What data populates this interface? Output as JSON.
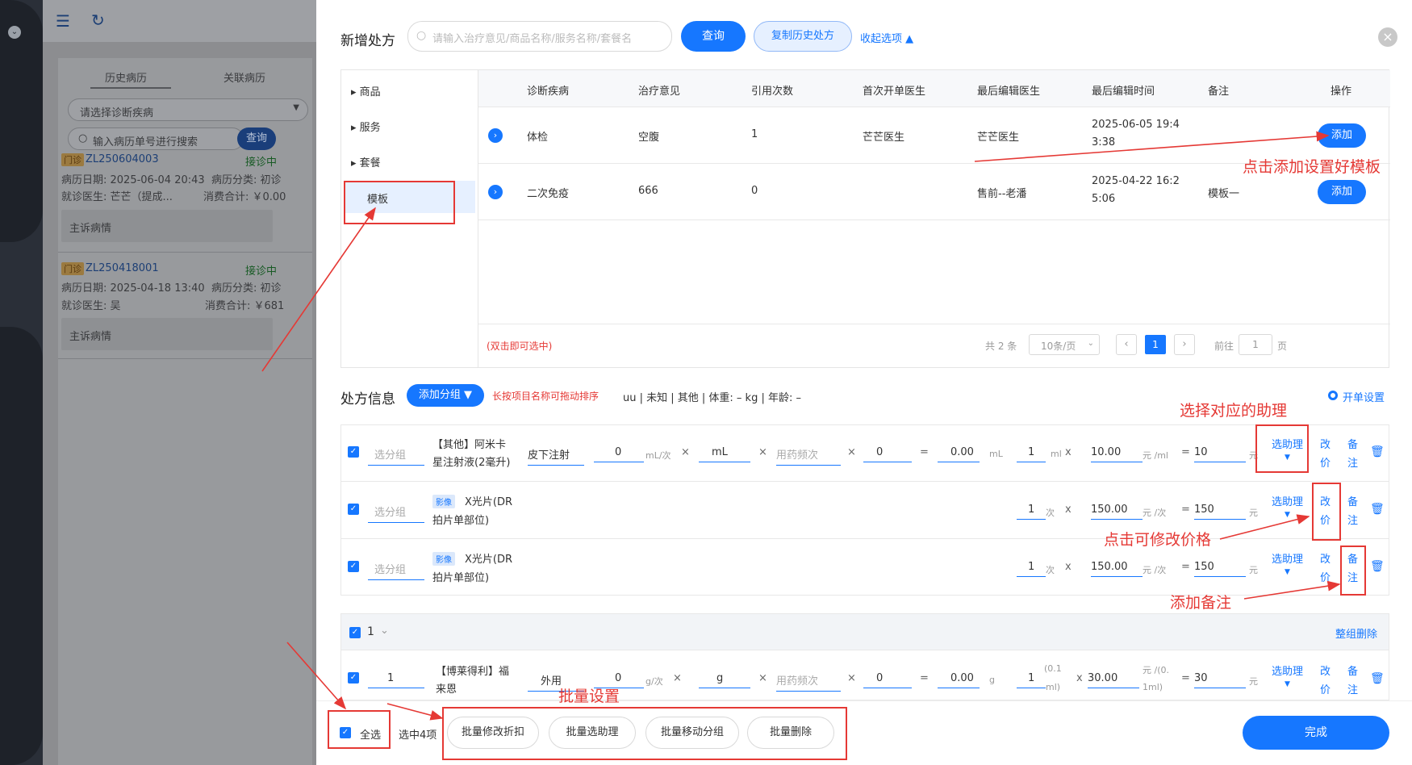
{
  "background": {
    "tabs": [
      "历史病历",
      "关联病历"
    ],
    "diagnosis_placeholder": "请选择诊断疾病",
    "search_placeholder": "输入病历单号进行搜索",
    "search_button": "查询",
    "records": [
      {
        "type": "门诊",
        "id": "ZL250604003",
        "status": "接诊中",
        "date": "病历日期: 2025-06-04 20:43",
        "category": "病历分类: 初诊",
        "doctor": "就诊医生: 芒芒（提成...",
        "cost": "消费合计: ￥0.00",
        "complaint": "主诉病情"
      },
      {
        "type": "门诊",
        "id": "ZL250418001",
        "status": "接诊中",
        "date": "病历日期: 2025-04-18 13:40",
        "category": "病历分类: 初诊",
        "doctor": "就诊医生: 吴",
        "cost": "消费合计: ￥681",
        "complaint": "主诉病情"
      }
    ]
  },
  "header": {
    "title": "新增处方",
    "search_placeholder": "请输入治疗意见/商品名称/服务名称/套餐名",
    "query_button": "查询",
    "copy_button": "复制历史处方",
    "collapse_link": "收起选项 ▲",
    "close_icon": "×"
  },
  "categories": [
    "商品",
    "服务",
    "套餐",
    "模板"
  ],
  "template_table": {
    "headers": [
      "诊断疾病",
      "治疗意见",
      "引用次数",
      "首次开单医生",
      "最后编辑医生",
      "最后编辑时间",
      "备注",
      "操作"
    ],
    "rows": [
      {
        "disease": "体检",
        "opinion": "空腹",
        "count": "1",
        "first_doctor": "芒芒医生",
        "last_doctor": "芒芒医生",
        "time1": "2025-06-05 19:4",
        "time2": "3:38",
        "note": "",
        "action": "添加"
      },
      {
        "disease": "二次免疫",
        "opinion": "666",
        "count": "0",
        "first_doctor": "",
        "last_doctor": "售前--老潘",
        "time1": "2025-04-22 16:2",
        "time2": "5:06",
        "note": "模板一",
        "action": "添加"
      }
    ],
    "hint": "(双击即可选中)",
    "total": "共 2 条",
    "page_size": "10条/页",
    "current_page": "1",
    "goto_label": "前往",
    "goto_value": "1",
    "page_suffix": "页"
  },
  "prescription": {
    "title": "处方信息",
    "add_group": "添加分组 ▼",
    "drag_hint": "长按项目名称可拖动排序",
    "patient_info": "uu | 未知 | 其他 | 体重: – kg | 年龄: –",
    "settings_link": "开单设置",
    "items": [
      {
        "group": "选分组",
        "name1": "【其他】阿米卡",
        "name2": "星注射液(2毫升)",
        "route": "皮下注射",
        "dose": "0",
        "dose_unit": "mL/次",
        "unit": "mL",
        "freq": "用药频次",
        "days": "0",
        "amount": "0.00",
        "amount_unit": "mL",
        "qty": "1",
        "qty_unit": "ml",
        "price": "10.00",
        "price_unit": "元 /ml",
        "total": "10",
        "total_unit": "元"
      },
      {
        "group": "选分组",
        "tag": "影像",
        "name1": "X光片(DR",
        "name2": "拍片单部位)",
        "qty": "1",
        "qty_unit": "次",
        "price": "150.00",
        "price_unit": "元 /次",
        "total": "150",
        "total_unit": "元"
      },
      {
        "group": "选分组",
        "tag": "影像",
        "name1": "X光片(DR",
        "name2": "拍片单部位)",
        "qty": "1",
        "qty_unit": "次",
        "price": "150.00",
        "price_unit": "元 /次",
        "total": "150",
        "total_unit": "元"
      }
    ],
    "ops": {
      "assistant": "选助理",
      "price1": "改",
      "price2": "价",
      "note1": "备",
      "note2": "注"
    },
    "group_row": {
      "label": "1",
      "delete": "整组删除"
    },
    "group_item": {
      "group": "1",
      "name1": "【博莱得利】福",
      "name2": "来恩",
      "route": "外用",
      "dose": "0",
      "dose_unit": "g/次",
      "unit": "g",
      "freq": "用药频次",
      "days": "0",
      "amount": "0.00",
      "amount_unit": "g",
      "qty": "1",
      "qty_unit1": "(0.1",
      "qty_unit2": "ml)",
      "price": "30.00",
      "price_unit1": "元 /(0.",
      "price_unit2": "1ml)",
      "total": "30",
      "total_unit": "元"
    }
  },
  "footer": {
    "select_all": "全选",
    "selected": "选中4项",
    "batch_buttons": [
      "批量修改折扣",
      "批量选助理",
      "批量移动分组",
      "批量删除"
    ],
    "done": "完成"
  },
  "annotations": {
    "add_template": "点击添加设置好模板",
    "select_assistant": "选择对应的助理",
    "modify_price": "点击可修改价格",
    "add_note": "添加备注",
    "batch": "批量设置"
  },
  "colors": {
    "primary": "#1677ff",
    "annotation": "#e53935",
    "sidebar": "#2a2f38"
  }
}
